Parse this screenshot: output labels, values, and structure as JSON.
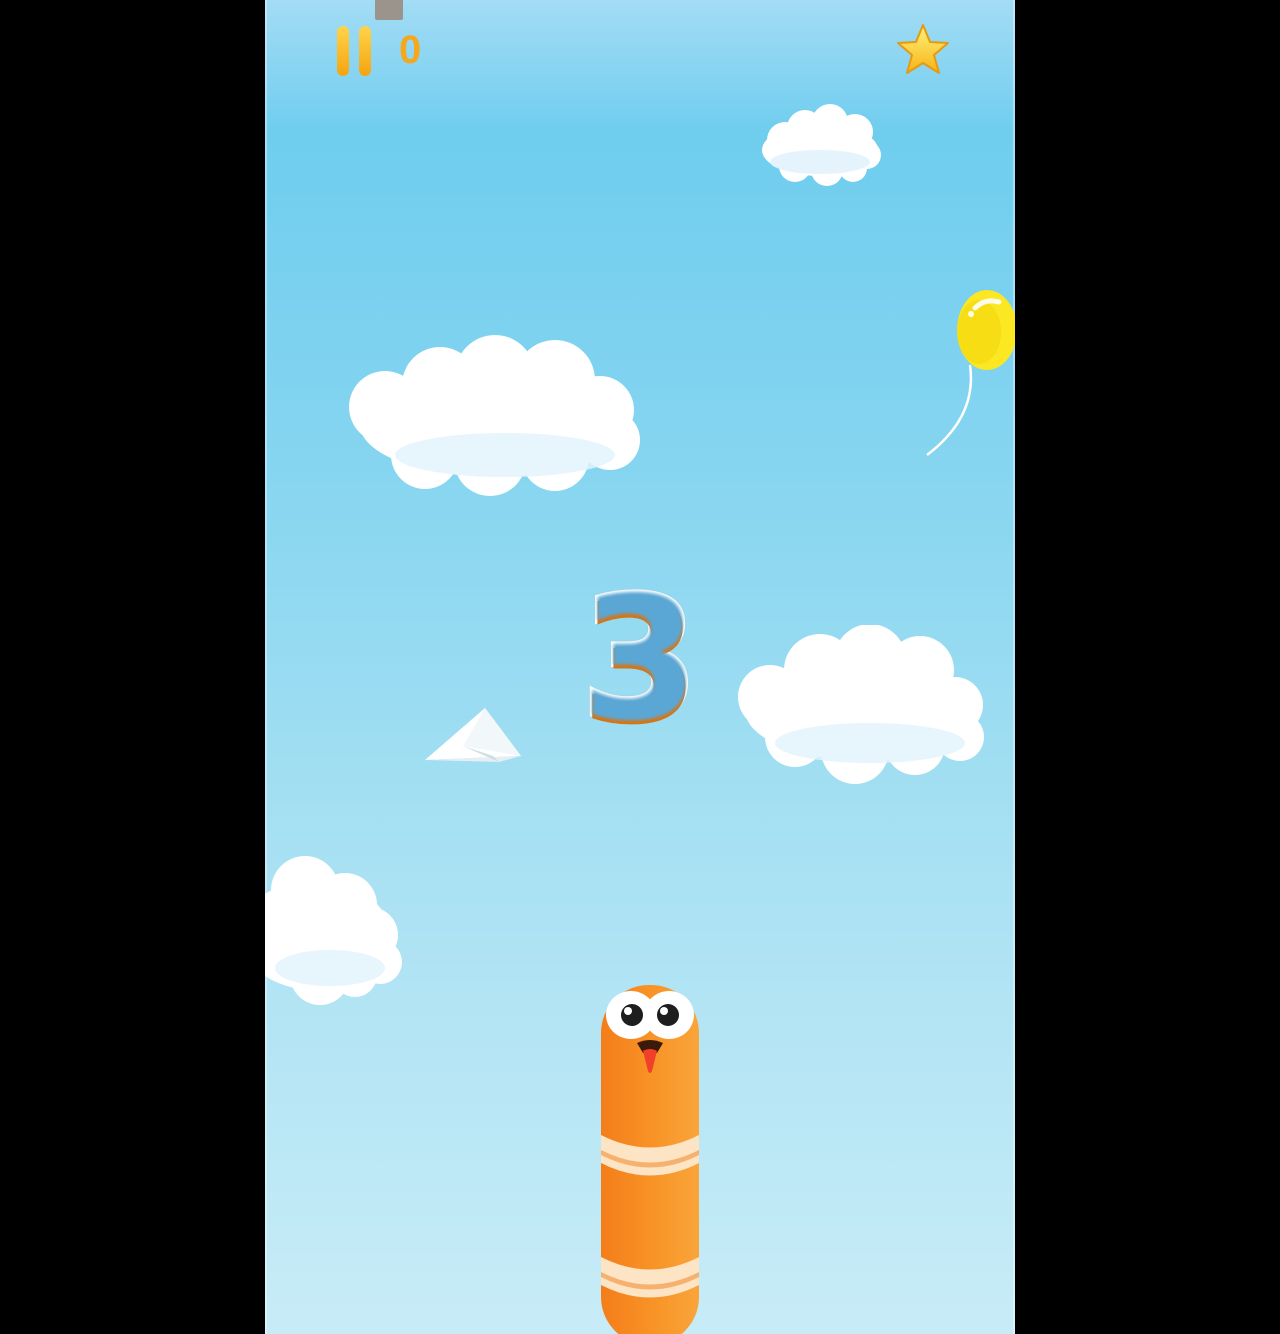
{
  "hud": {
    "score": "0",
    "pause_icon": "pause-icon",
    "star_icon": "star-icon"
  },
  "countdown": "3",
  "colors": {
    "sky_top": "#6fcdee",
    "sky_bottom": "#c8ecf7",
    "accent_orange": "#f6a71c",
    "star_yellow": "#ffd740",
    "balloon_yellow": "#fbe722",
    "worm_orange": "#f58a1c",
    "worm_stripe": "#fde4c4"
  },
  "scene_objects": [
    "cloud",
    "cloud",
    "cloud",
    "cloud",
    "balloon",
    "paper-plane",
    "worm"
  ]
}
